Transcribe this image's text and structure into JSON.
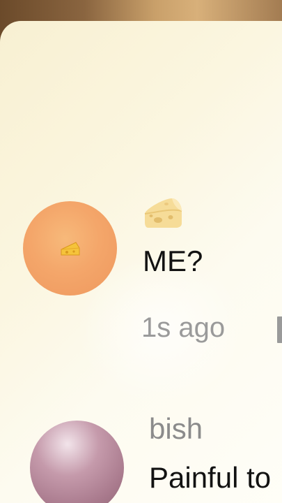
{
  "comments": [
    {
      "author_icon": "cheese-icon",
      "avatar_icon": "cheese-icon",
      "text": "ME?",
      "time": "1s ago"
    },
    {
      "author": "bish",
      "text": "Painful to"
    }
  ],
  "colors": {
    "sheet_bg": "#fbf6e0",
    "text": "#121212",
    "muted": "#9a9a9a",
    "avatar_orange": "#f4a66a",
    "avatar_pink": "#c59aab"
  }
}
